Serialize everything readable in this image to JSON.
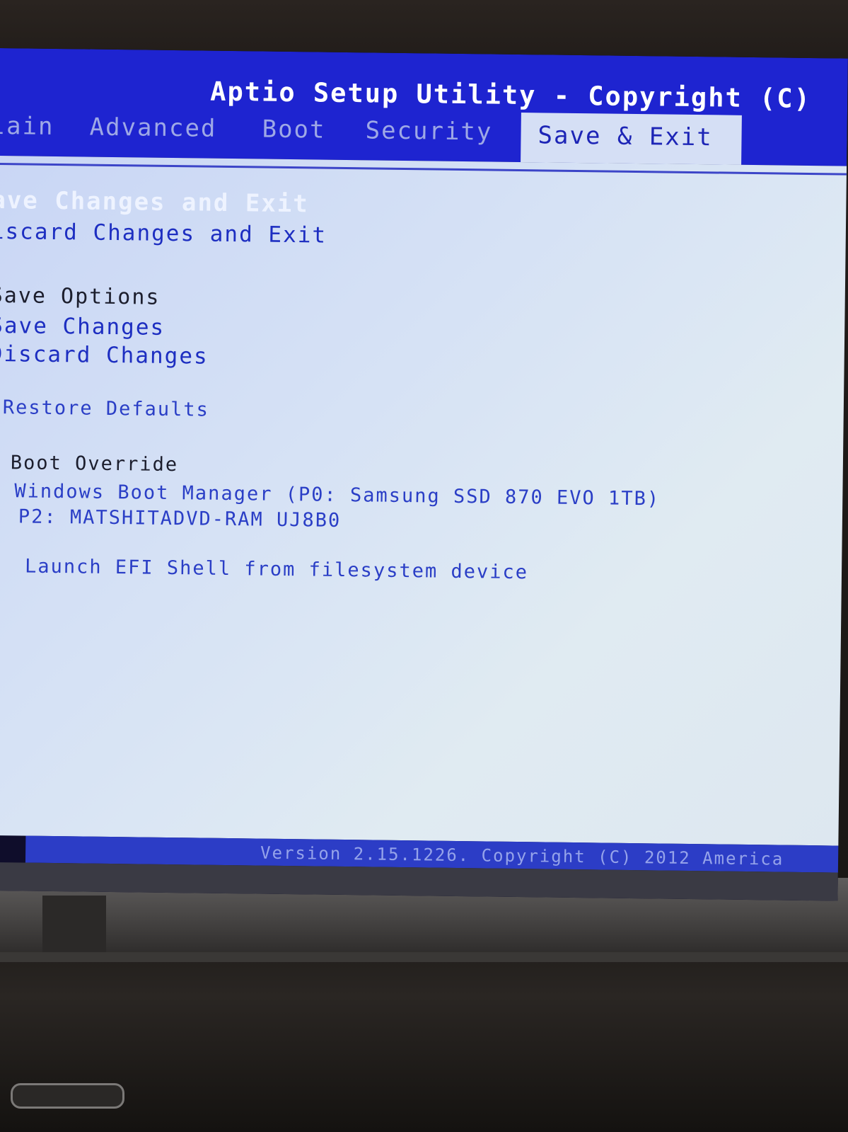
{
  "window": {
    "title": "Aptio Setup Utility - Copyright (C)"
  },
  "tabs": [
    {
      "label": "lain"
    },
    {
      "label": "Advanced"
    },
    {
      "label": "Boot"
    },
    {
      "label": "Security"
    },
    {
      "label": "Save & Exit",
      "selected": true
    }
  ],
  "menu": {
    "save_and_exit": "ave Changes and Exit",
    "discard_and_exit": "iscard Changes and Exit",
    "save_options_heading": "Save Options",
    "save_changes": "Save Changes",
    "discard_changes": "Discard Changes",
    "restore_defaults": "Restore Defaults",
    "boot_override_heading": "Boot Override",
    "boot_devices": [
      "Windows Boot Manager (P0: Samsung SSD 870 EVO 1TB)",
      "P2: MATSHITADVD-RAM UJ8B0"
    ],
    "efi_shell": "Launch EFI Shell from filesystem device"
  },
  "footer": {
    "version": "Version 2.15.1226. Copyright (C) 2012 America"
  },
  "colors": {
    "header_blue": "#1e24d0",
    "panel_bg": "#d6e2f5",
    "link_blue": "#1d2ec1",
    "highlight_text": "#eef3ff"
  }
}
